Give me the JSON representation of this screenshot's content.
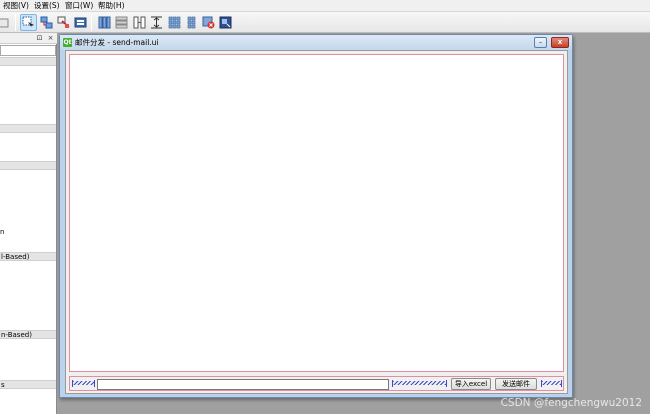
{
  "menubar": {
    "items": [
      {
        "label": "视图(V)"
      },
      {
        "label": "设置(S)"
      },
      {
        "label": "窗口(W)"
      },
      {
        "label": "帮助(H)"
      }
    ]
  },
  "left_dock": {
    "float_icon": "⊡",
    "close_icon": "×",
    "scroll_arrow": "▲",
    "groups": [
      {
        "label": ""
      },
      {
        "label": ""
      },
      {
        "label": "l-Based)"
      },
      {
        "label": "n-Based)"
      },
      {
        "label": "s"
      }
    ],
    "texts": [
      {
        "label": "n"
      }
    ]
  },
  "form_window": {
    "title": "邮件分发 - send-mail.ui",
    "icon_text": "Qt",
    "minimize_symbol": "–",
    "maximize_symbol": "□",
    "close_symbol": "x",
    "buttons": {
      "import_label": "导入excel",
      "send_label": "发送邮件"
    }
  },
  "watermark": "CSDN @fengchengwu2012",
  "colors": {
    "layout_border": "#e18ea0",
    "spacer": "#3949c8",
    "toolbar_active": "#cde6f7"
  }
}
